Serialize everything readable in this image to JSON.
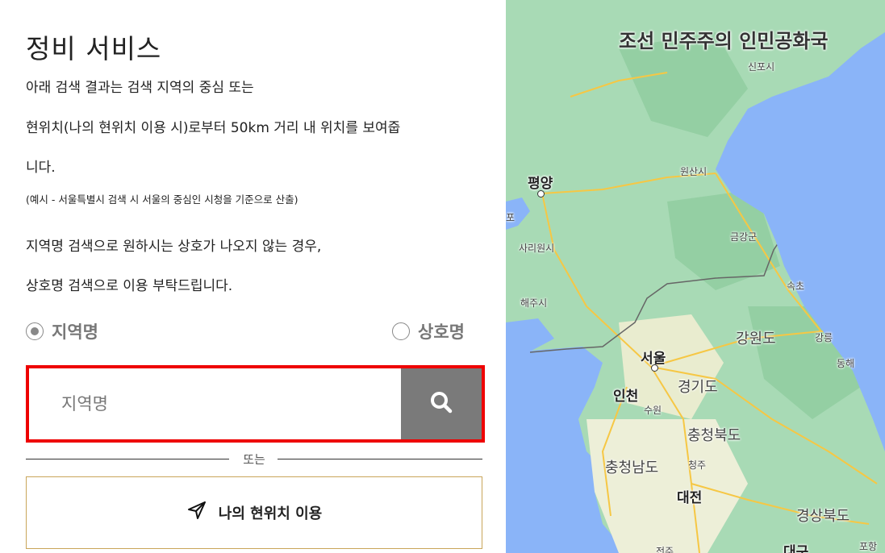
{
  "panel": {
    "title": "정비 서비스",
    "desc_line1": "아래 검색 결과는 검색 지역의 중심 또는",
    "desc_line2": "현위치(나의 현위치 이용 시)로부터 50km 거리 내 위치를 보여줍",
    "desc_line3": "니다.",
    "desc_note": "(예시 - 서울특별시 검색 시 서울의 중심인 시청을 기준으로 산출)",
    "desc_line4": "지역명 검색으로 원하시는 상호가 나오지 않는 경우,",
    "desc_line5": "상호명 검색으로 이용 부탁드립니다.",
    "radio_region": "지역명",
    "radio_shop": "상호명",
    "search_placeholder": "지역명",
    "or_text": "또는",
    "location_button": "나의 현위치 이용"
  },
  "icons": {
    "search": "search-icon",
    "location": "navigation-arrow-icon",
    "radio_selected": "radio-selected-icon",
    "radio_unselected": "radio-unselected-icon"
  },
  "colors": {
    "search_border": "#ee0000",
    "search_button": "#7a7a7a",
    "location_button_border": "#c9a55a",
    "sea": "#8ab4f8",
    "land": "#a8dab5"
  },
  "map": {
    "country_north": "조선 민주주의 인민공화국",
    "labels": {
      "sinpo": "신포시",
      "wonsan": "원산시",
      "pyongyang": "평양",
      "sariwon": "사리원시",
      "kumgang": "금강군",
      "haeju": "해주시",
      "sokcho": "속초",
      "gangwon": "강원도",
      "gangneung": "강릉",
      "donghae": "동해",
      "seoul": "서울",
      "gyeonggi": "경기도",
      "incheon": "인천",
      "suwon": "수원",
      "chungbuk": "충청북도",
      "chungnam": "충청남도",
      "cheongju": "청주",
      "daejeon": "대전",
      "gyeongbuk": "경상북도",
      "pohang": "포항",
      "daegu": "대구",
      "jeonju": "전주",
      "nampo": "포"
    }
  }
}
